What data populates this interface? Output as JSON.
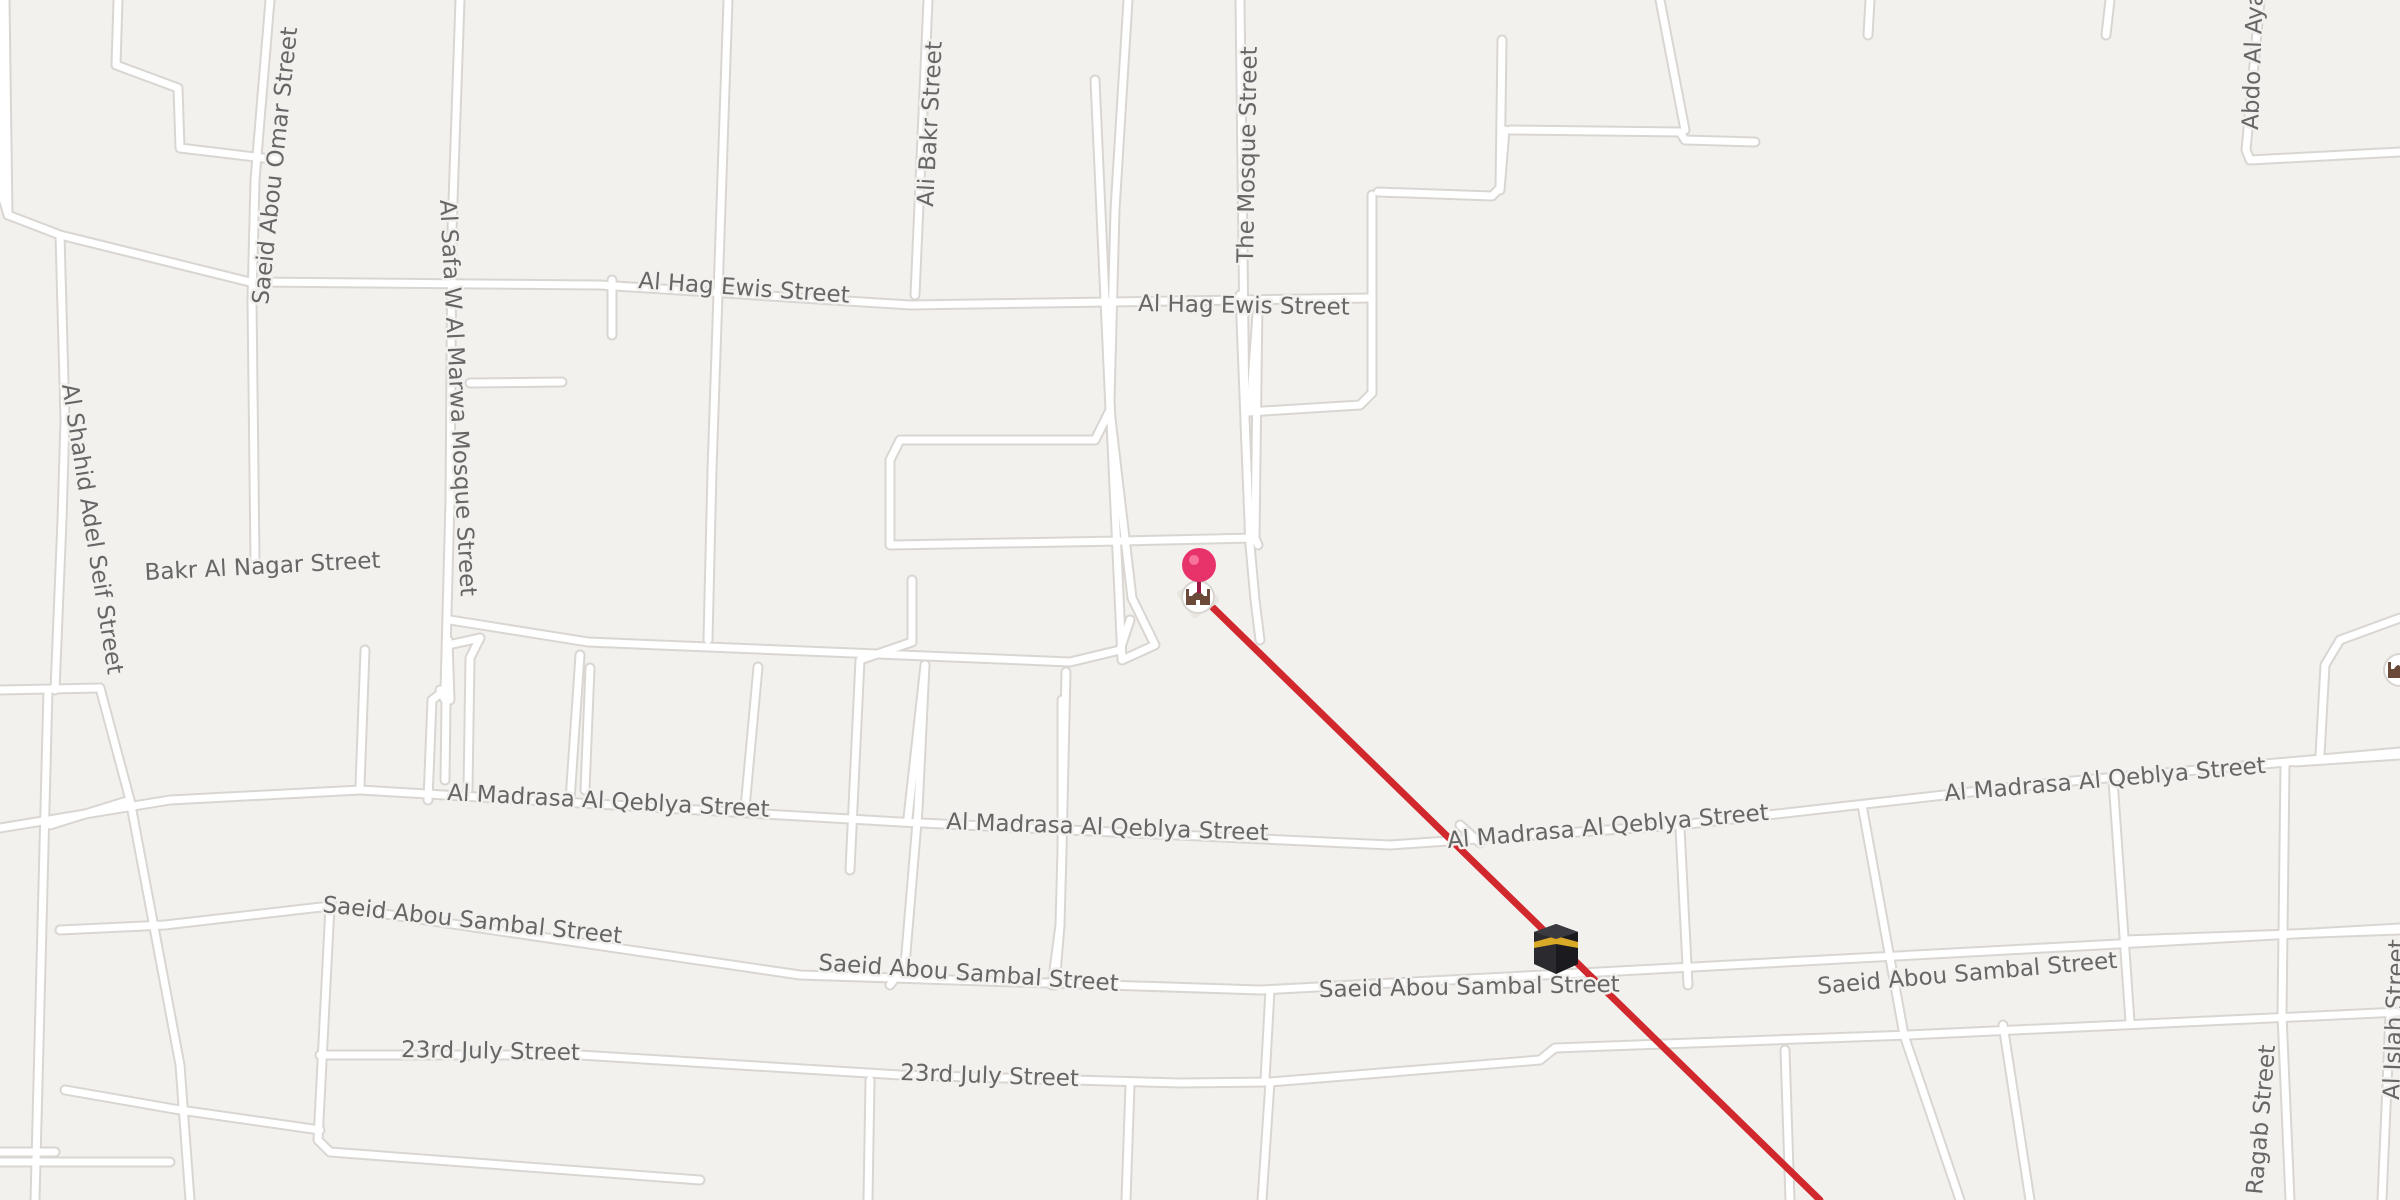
{
  "map": {
    "background_color": "#f3f1ee",
    "road_color": "#ffffff",
    "road_casing_color": "#d9d6d2",
    "label_color": "#666666",
    "route_color": "#d1282e",
    "pin_color": "#e8336a"
  },
  "labels": {
    "saeid_abou_omar": "Saeid Abou Omar Street",
    "al_safa_marwa": "Al Safa W Al Marwa Mosque Street",
    "ali_bakr": "Ali Bakr Street",
    "mosque_street": "The Mosque Street",
    "abdo_al_ayad": "Abdo Al Ayad",
    "hag_ewis_1": "Al Hag Ewis Street",
    "hag_ewis_2": "Al Hag Ewis Street",
    "shahid_adel": "Al Shahid Adel Seif Street",
    "bakr_nagar": "Bakr Al Nagar Street",
    "madrasa_1": "Al Madrasa Al Qeblya Street",
    "madrasa_2": "Al Madrasa Al Qeblya Street",
    "madrasa_3": "Al Madrasa Al Qeblya Street",
    "madrasa_4": "Al Madrasa Al Qeblya Street",
    "sambal_1": "Saeid Abou Sambal Street",
    "sambal_2": "Saeid Abou Sambal Street",
    "sambal_3": "Saeid Abou Sambal Street",
    "sambal_4": "Saeid Abou Sambal Street",
    "july_1": "23rd July Street",
    "july_2": "23rd July Street",
    "ragab": "Ragab Street",
    "al_islah": "Al Islah Street"
  },
  "markers": {
    "location_pin": "location-pin-icon",
    "mosque_poi": "mosque-icon",
    "kaaba_poi": "kaaba-icon",
    "mosque_poi_right": "mosque-icon"
  },
  "route": {
    "description_icon": "qibla-direction-line"
  }
}
